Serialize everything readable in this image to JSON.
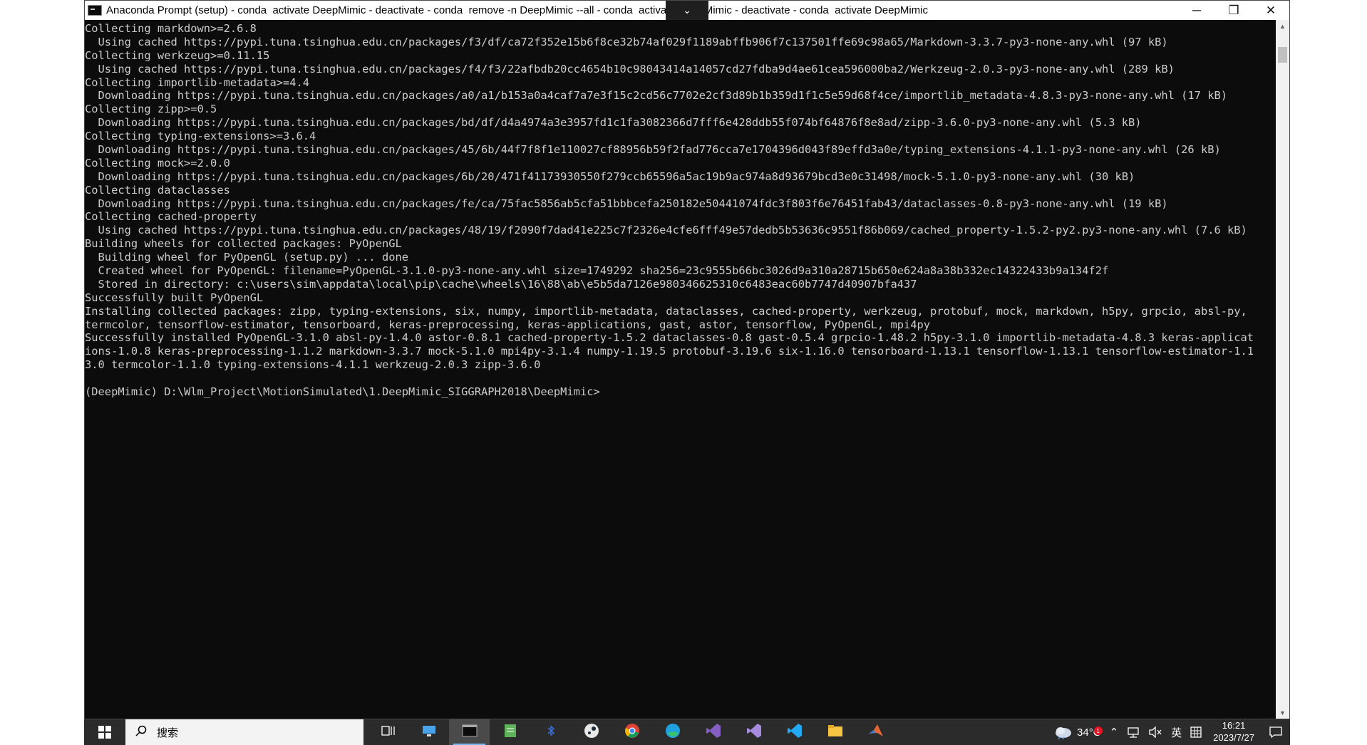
{
  "window": {
    "title": "Anaconda Prompt (setup) - conda  activate DeepMimic - deactivate - conda  remove -n DeepMimic --all - conda  activate DeepMimic - deactivate - conda  activate DeepMimic",
    "dropdown_icon": "chevron-down-icon",
    "controls": {
      "minimize": "─",
      "maximize": "❐",
      "close": "✕"
    }
  },
  "console": {
    "lines": [
      "Collecting markdown>=2.6.8",
      "  Using cached https://pypi.tuna.tsinghua.edu.cn/packages/f3/df/ca72f352e15b6f8ce32b74af029f1189abffb906f7c137501ffe69c98a65/Markdown-3.3.7-py3-none-any.whl (97 kB)",
      "Collecting werkzeug>=0.11.15",
      "  Using cached https://pypi.tuna.tsinghua.edu.cn/packages/f4/f3/22afbdb20cc4654b10c98043414a14057cd27fdba9d4ae61cea596000ba2/Werkzeug-2.0.3-py3-none-any.whl (289 kB)",
      "Collecting importlib-metadata>=4.4",
      "  Downloading https://pypi.tuna.tsinghua.edu.cn/packages/a0/a1/b153a0a4caf7a7e3f15c2cd56c7702e2cf3d89b1b359d1f1c5e59d68f4ce/importlib_metadata-4.8.3-py3-none-any.whl (17 kB)",
      "Collecting zipp>=0.5",
      "  Downloading https://pypi.tuna.tsinghua.edu.cn/packages/bd/df/d4a4974a3e3957fd1c1fa3082366d7fff6e428ddb55f074bf64876f8e8ad/zipp-3.6.0-py3-none-any.whl (5.3 kB)",
      "Collecting typing-extensions>=3.6.4",
      "  Downloading https://pypi.tuna.tsinghua.edu.cn/packages/45/6b/44f7f8f1e110027cf88956b59f2fad776cca7e1704396d043f89effd3a0e/typing_extensions-4.1.1-py3-none-any.whl (26 kB)",
      "Collecting mock>=2.0.0",
      "  Downloading https://pypi.tuna.tsinghua.edu.cn/packages/6b/20/471f41173930550f279ccb65596a5ac19b9ac974a8d93679bcd3e0c31498/mock-5.1.0-py3-none-any.whl (30 kB)",
      "Collecting dataclasses",
      "  Downloading https://pypi.tuna.tsinghua.edu.cn/packages/fe/ca/75fac5856ab5cfa51bbbcefa250182e50441074fdc3f803f6e76451fab43/dataclasses-0.8-py3-none-any.whl (19 kB)",
      "Collecting cached-property",
      "  Using cached https://pypi.tuna.tsinghua.edu.cn/packages/48/19/f2090f7dad41e225c7f2326e4cfe6fff49e57dedb5b53636c9551f86b069/cached_property-1.5.2-py2.py3-none-any.whl (7.6 kB)",
      "Building wheels for collected packages: PyOpenGL",
      "  Building wheel for PyOpenGL (setup.py) ... done",
      "  Created wheel for PyOpenGL: filename=PyOpenGL-3.1.0-py3-none-any.whl size=1749292 sha256=23c9555b66bc3026d9a310a28715b650e624a8a38b332ec14322433b9a134f2f",
      "  Stored in directory: c:\\users\\sim\\appdata\\local\\pip\\cache\\wheels\\16\\88\\ab\\e5b5da7126e980346625310c6483eac60b7747d40907bfa437",
      "Successfully built PyOpenGL",
      "Installing collected packages: zipp, typing-extensions, six, numpy, importlib-metadata, dataclasses, cached-property, werkzeug, protobuf, mock, markdown, h5py, grpcio, absl-py,",
      "termcolor, tensorflow-estimator, tensorboard, keras-preprocessing, keras-applications, gast, astor, tensorflow, PyOpenGL, mpi4py",
      "Successfully installed PyOpenGL-3.1.0 absl-py-1.4.0 astor-0.8.1 cached-property-1.5.2 dataclasses-0.8 gast-0.5.4 grpcio-1.48.2 h5py-3.1.0 importlib-metadata-4.8.3 keras-applicat",
      "ions-1.0.8 keras-preprocessing-1.1.2 markdown-3.3.7 mock-5.1.0 mpi4py-3.1.4 numpy-1.19.5 protobuf-3.19.6 six-1.16.0 tensorboard-1.13.1 tensorflow-1.13.1 tensorflow-estimator-1.1",
      "3.0 termcolor-1.1.0 typing-extensions-4.1.1 werkzeug-2.0.3 zipp-3.6.0",
      "",
      "(DeepMimic) D:\\Wlm_Project\\MotionSimulated\\1.DeepMimic_SIGGRAPH2018\\DeepMimic>"
    ]
  },
  "taskbar": {
    "search_placeholder": "搜索",
    "apps": [
      {
        "name": "task-view-icon",
        "active": false
      },
      {
        "name": "remote-desktop-icon",
        "active": false
      },
      {
        "name": "terminal-icon",
        "active": true
      },
      {
        "name": "notepad-icon",
        "active": false
      },
      {
        "name": "bluetooth-app-icon",
        "active": false
      },
      {
        "name": "steam-icon",
        "active": false
      },
      {
        "name": "chrome-icon",
        "active": false
      },
      {
        "name": "edge-icon",
        "active": false
      },
      {
        "name": "visual-studio-icon",
        "active": false
      },
      {
        "name": "visual-studio-preview-icon",
        "active": false
      },
      {
        "name": "vscode-icon",
        "active": false
      },
      {
        "name": "file-explorer-icon",
        "active": false
      },
      {
        "name": "matlab-icon",
        "active": false
      }
    ],
    "weather": {
      "temp": "34°C",
      "badge": "1"
    },
    "ime": "英",
    "clock": {
      "time": "16:21",
      "date": "2023/7/27"
    }
  }
}
